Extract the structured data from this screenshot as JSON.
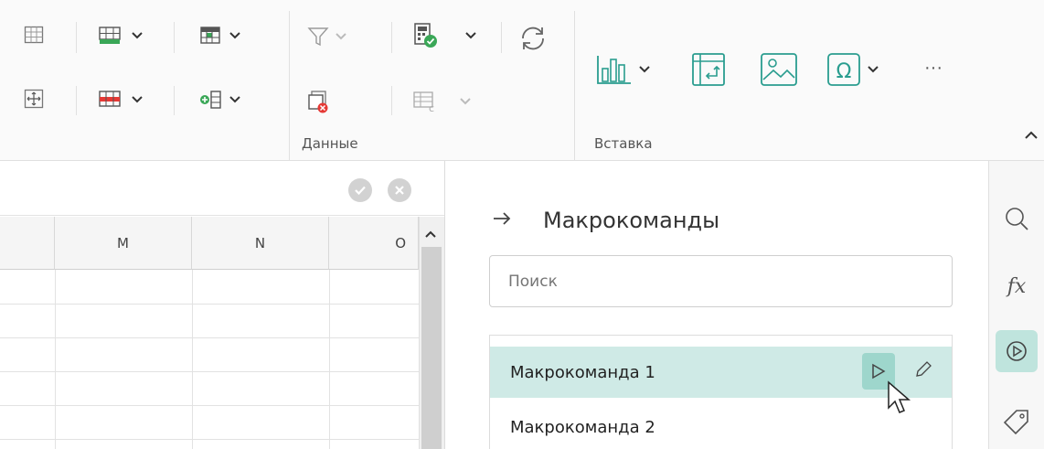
{
  "ribbon": {
    "groups": [
      {
        "label": "Данные"
      },
      {
        "label": "Вставка"
      }
    ],
    "icons": [
      "table-grid-icon",
      "move-table-icon",
      "insert-row-icon",
      "delete-row-icon",
      "insert-table-icon",
      "insert-column-icon",
      "filter-icon",
      "clear-filter-icon",
      "calculate-icon",
      "recalculate-icon",
      "refresh-icon",
      "chart-icon",
      "pivot-table-icon",
      "image-icon",
      "symbol-icon",
      "more-icon",
      "collapse-ribbon-icon"
    ],
    "more_label": "···"
  },
  "grid": {
    "columns": [
      "M",
      "N",
      "O"
    ]
  },
  "macros_panel": {
    "title": "Макрокоманды",
    "search_placeholder": "Поиск",
    "items": [
      {
        "label": "Макрокоманда 1",
        "selected": true
      },
      {
        "label": "Макрокоманда 2",
        "selected": false
      }
    ]
  },
  "sidebar": {
    "icons": [
      "search-icon",
      "function-icon",
      "macros-icon",
      "tag-icon"
    ],
    "fx_label": "fx"
  },
  "colors": {
    "accent": "#2a9d8f",
    "selection": "#cfeae6",
    "active_button": "#9ed6cc",
    "error_red": "#e53935",
    "ok_green": "#3aa757"
  }
}
